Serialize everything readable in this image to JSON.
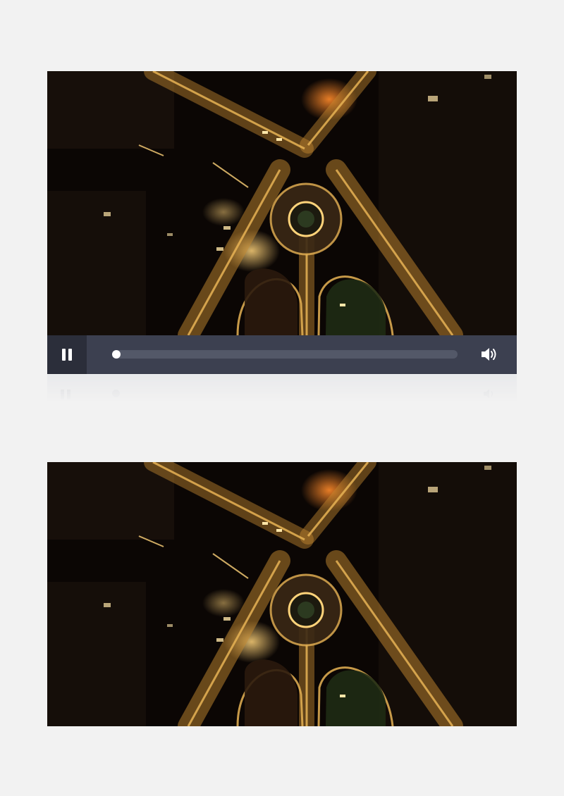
{
  "player": {
    "state": "playing",
    "play_pause_icon": "pause-icon",
    "volume_icon": "volume-icon",
    "progress_fraction": 0.0
  },
  "video": {
    "scene": "aerial-night-roundabout",
    "colors": {
      "background": "#0b0604",
      "road_glow": "#d9a441",
      "highlight": "#ffd37a",
      "control_bar": "#3c4050",
      "play_button_bg": "#2b2e3a",
      "page_bg": "#f2f2f2"
    }
  }
}
